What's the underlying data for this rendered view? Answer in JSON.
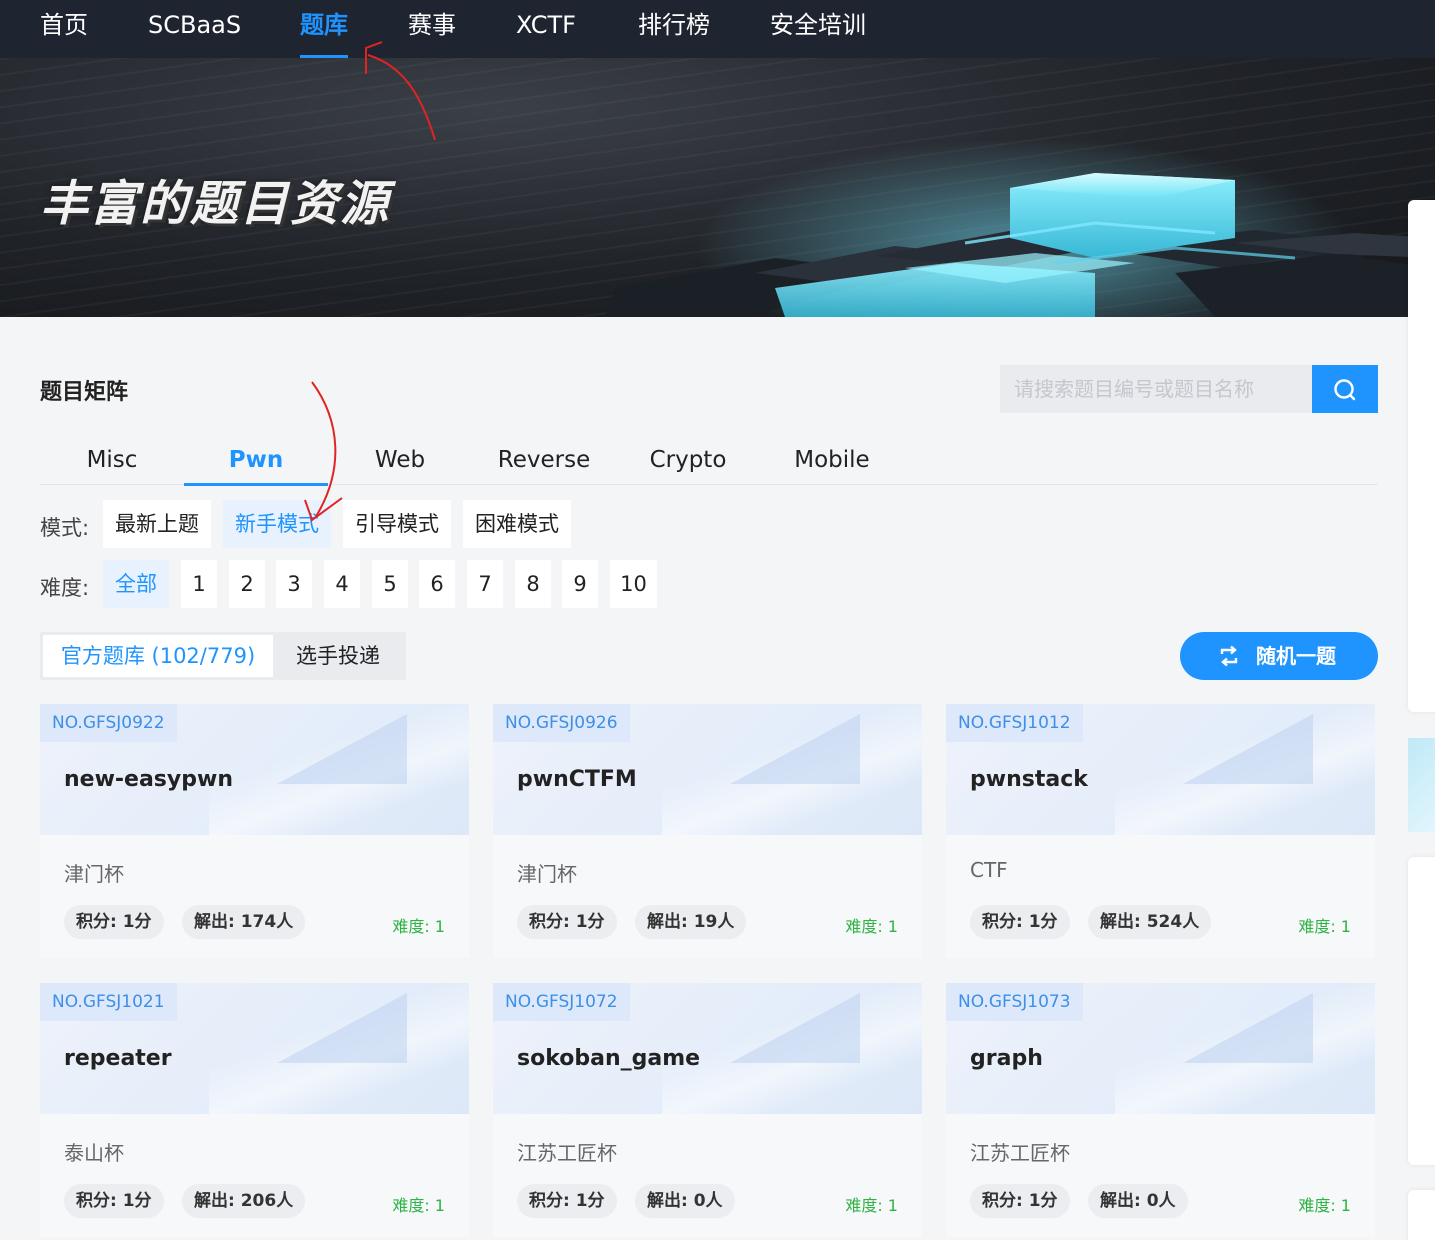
{
  "nav": {
    "items": [
      {
        "label": "首页"
      },
      {
        "label": "SCBaaS"
      },
      {
        "label": "题库",
        "active": true
      },
      {
        "label": "赛事"
      },
      {
        "label": "XCTF"
      },
      {
        "label": "排行榜"
      },
      {
        "label": "安全培训"
      }
    ]
  },
  "banner": {
    "title": "丰富的题目资源"
  },
  "section": {
    "title": "题目矩阵",
    "search_placeholder": "请搜索题目编号或题目名称",
    "search_icon": "search-icon"
  },
  "categories": [
    {
      "label": "Misc"
    },
    {
      "label": "Pwn",
      "active": true
    },
    {
      "label": "Web"
    },
    {
      "label": "Reverse"
    },
    {
      "label": "Crypto"
    },
    {
      "label": "Mobile"
    }
  ],
  "mode": {
    "label": "模式:",
    "options": [
      {
        "label": "最新上题"
      },
      {
        "label": "新手模式",
        "active": true
      },
      {
        "label": "引导模式"
      },
      {
        "label": "困难模式"
      }
    ]
  },
  "difficulty": {
    "label": "难度:",
    "options": [
      {
        "label": "全部",
        "active": true
      },
      {
        "label": "1"
      },
      {
        "label": "2"
      },
      {
        "label": "3"
      },
      {
        "label": "4"
      },
      {
        "label": "5"
      },
      {
        "label": "6"
      },
      {
        "label": "7"
      },
      {
        "label": "8"
      },
      {
        "label": "9"
      },
      {
        "label": "10"
      }
    ]
  },
  "source_tabs": [
    {
      "label": "官方题库 (102/779)",
      "active": true
    },
    {
      "label": "选手投递"
    }
  ],
  "random_button": {
    "label": "随机一题",
    "icon": "shuffle-icon"
  },
  "cards": [
    {
      "no": "NO.GFSJ0922",
      "name": "new-easypwn",
      "source": "津门杯",
      "score": "积分: 1分",
      "solved": "解出: 174人",
      "difficulty": "难度: 1"
    },
    {
      "no": "NO.GFSJ0926",
      "name": "pwnCTFM",
      "source": "津门杯",
      "score": "积分: 1分",
      "solved": "解出: 19人",
      "difficulty": "难度: 1"
    },
    {
      "no": "NO.GFSJ1012",
      "name": "pwnstack",
      "source": "CTF",
      "score": "积分: 1分",
      "solved": "解出: 524人",
      "difficulty": "难度: 1"
    },
    {
      "no": "NO.GFSJ1021",
      "name": "repeater",
      "source": "泰山杯",
      "score": "积分: 1分",
      "solved": "解出: 206人",
      "difficulty": "难度: 1"
    },
    {
      "no": "NO.GFSJ1072",
      "name": "sokoban_game",
      "source": "江苏工匠杯",
      "score": "积分: 1分",
      "solved": "解出: 0人",
      "difficulty": "难度: 1"
    },
    {
      "no": "NO.GFSJ1073",
      "name": "graph",
      "source": "江苏工匠杯",
      "score": "积分: 1分",
      "solved": "解出: 0人",
      "difficulty": "难度: 1"
    }
  ],
  "colors": {
    "accent": "#1f94ff",
    "nav_bg": "#1e2430",
    "difficulty_green": "#2fb344",
    "annotation_red": "#e02424"
  }
}
